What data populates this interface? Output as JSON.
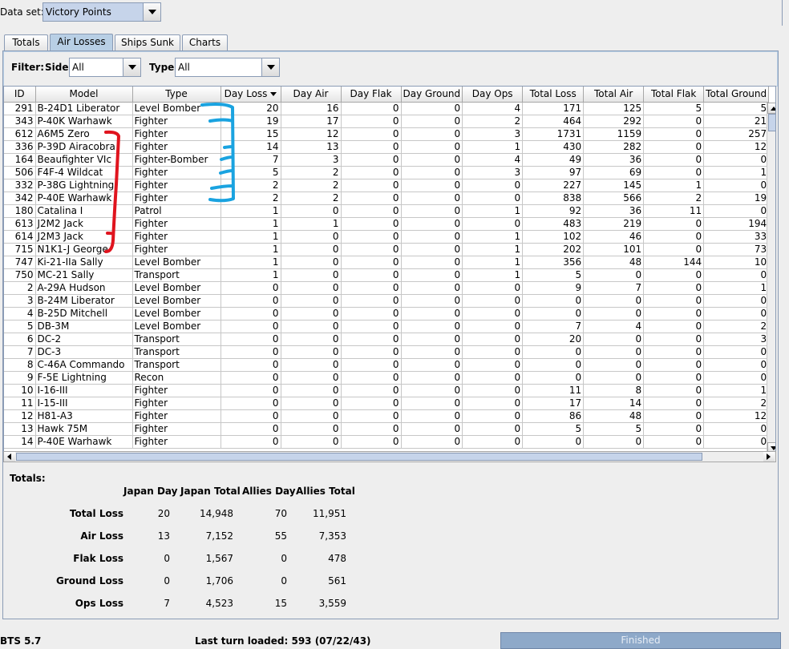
{
  "dataset": {
    "label": "Data set:",
    "value": "Victory Points"
  },
  "tabs": [
    {
      "label": "Totals"
    },
    {
      "label": "Air Losses"
    },
    {
      "label": "Ships Sunk"
    },
    {
      "label": "Charts"
    }
  ],
  "filter": {
    "label": "Filter:",
    "side_label": "Side:",
    "side_value": "All",
    "type_label": "Type:",
    "type_value": "All"
  },
  "table": {
    "columns": [
      "ID",
      "Model",
      "Type",
      "Day Loss",
      "Day Air",
      "Day Flak",
      "Day Ground",
      "Day Ops",
      "Total Loss",
      "Total Air",
      "Total Flak",
      "Total Ground"
    ],
    "sorted_column": "Day Loss",
    "rows": [
      [
        "291",
        "B-24D1 Liberator",
        "Level Bomber",
        "20",
        "16",
        "0",
        "0",
        "4",
        "171",
        "125",
        "5",
        "5"
      ],
      [
        "343",
        "P-40K Warhawk",
        "Fighter",
        "19",
        "17",
        "0",
        "0",
        "2",
        "464",
        "292",
        "0",
        "21"
      ],
      [
        "612",
        "A6M5 Zero",
        "Fighter",
        "15",
        "12",
        "0",
        "0",
        "3",
        "1731",
        "1159",
        "0",
        "257"
      ],
      [
        "336",
        "P-39D Airacobra",
        "Fighter",
        "14",
        "13",
        "0",
        "0",
        "1",
        "430",
        "282",
        "0",
        "12"
      ],
      [
        "164",
        "Beaufighter VIc",
        "Fighter-Bomber",
        "7",
        "3",
        "0",
        "0",
        "4",
        "49",
        "36",
        "0",
        "0"
      ],
      [
        "506",
        "F4F-4 Wildcat",
        "Fighter",
        "5",
        "2",
        "0",
        "0",
        "3",
        "97",
        "69",
        "0",
        "1"
      ],
      [
        "332",
        "P-38G Lightning",
        "Fighter",
        "2",
        "2",
        "0",
        "0",
        "0",
        "227",
        "145",
        "1",
        "0"
      ],
      [
        "342",
        "P-40E Warhawk",
        "Fighter",
        "2",
        "2",
        "0",
        "0",
        "0",
        "838",
        "566",
        "2",
        "19"
      ],
      [
        "180",
        "Catalina I",
        "Patrol",
        "1",
        "0",
        "0",
        "0",
        "1",
        "92",
        "36",
        "11",
        "0"
      ],
      [
        "613",
        "J2M2 Jack",
        "Fighter",
        "1",
        "1",
        "0",
        "0",
        "0",
        "483",
        "219",
        "0",
        "194"
      ],
      [
        "614",
        "J2M3 Jack",
        "Fighter",
        "1",
        "0",
        "0",
        "0",
        "1",
        "102",
        "46",
        "0",
        "33"
      ],
      [
        "715",
        "N1K1-J George",
        "Fighter",
        "1",
        "0",
        "0",
        "0",
        "1",
        "202",
        "101",
        "0",
        "73"
      ],
      [
        "747",
        "Ki-21-IIa Sally",
        "Level Bomber",
        "1",
        "0",
        "0",
        "0",
        "1",
        "356",
        "48",
        "144",
        "10"
      ],
      [
        "750",
        "MC-21 Sally",
        "Transport",
        "1",
        "0",
        "0",
        "0",
        "1",
        "5",
        "0",
        "0",
        "0"
      ],
      [
        "2",
        "A-29A Hudson",
        "Level Bomber",
        "0",
        "0",
        "0",
        "0",
        "0",
        "9",
        "7",
        "0",
        "1"
      ],
      [
        "3",
        "B-24M Liberator",
        "Level Bomber",
        "0",
        "0",
        "0",
        "0",
        "0",
        "0",
        "0",
        "0",
        "0"
      ],
      [
        "4",
        "B-25D Mitchell",
        "Level Bomber",
        "0",
        "0",
        "0",
        "0",
        "0",
        "0",
        "0",
        "0",
        "0"
      ],
      [
        "5",
        "DB-3M",
        "Level Bomber",
        "0",
        "0",
        "0",
        "0",
        "0",
        "7",
        "4",
        "0",
        "2"
      ],
      [
        "6",
        "DC-2",
        "Transport",
        "0",
        "0",
        "0",
        "0",
        "0",
        "20",
        "0",
        "0",
        "3"
      ],
      [
        "7",
        "DC-3",
        "Transport",
        "0",
        "0",
        "0",
        "0",
        "0",
        "0",
        "0",
        "0",
        "0"
      ],
      [
        "8",
        "C-46A Commando",
        "Transport",
        "0",
        "0",
        "0",
        "0",
        "0",
        "0",
        "0",
        "0",
        "0"
      ],
      [
        "9",
        "F-5E Lightning",
        "Recon",
        "0",
        "0",
        "0",
        "0",
        "0",
        "0",
        "0",
        "0",
        "0"
      ],
      [
        "10",
        "I-16-III",
        "Fighter",
        "0",
        "0",
        "0",
        "0",
        "0",
        "11",
        "8",
        "0",
        "1"
      ],
      [
        "11",
        "I-15-III",
        "Fighter",
        "0",
        "0",
        "0",
        "0",
        "0",
        "17",
        "14",
        "0",
        "2"
      ],
      [
        "12",
        "H81-A3",
        "Fighter",
        "0",
        "0",
        "0",
        "0",
        "0",
        "86",
        "48",
        "0",
        "12"
      ],
      [
        "13",
        "Hawk 75M",
        "Fighter",
        "0",
        "0",
        "0",
        "0",
        "0",
        "5",
        "5",
        "0",
        "0"
      ],
      [
        "14",
        "P-40E Warhawk",
        "Fighter",
        "0",
        "0",
        "0",
        "0",
        "0",
        "0",
        "0",
        "0",
        "0"
      ]
    ]
  },
  "totals": {
    "label": "Totals:",
    "headers": [
      "Japan Day",
      "Japan Total",
      "Allies Day",
      "Allies Total"
    ],
    "rows": [
      {
        "label": "Total Loss",
        "values": [
          "20",
          "14,948",
          "70",
          "11,951"
        ]
      },
      {
        "label": "Air Loss",
        "values": [
          "13",
          "7,152",
          "55",
          "7,353"
        ]
      },
      {
        "label": "Flak Loss",
        "values": [
          "0",
          "1,567",
          "0",
          "478"
        ]
      },
      {
        "label": "Ground Loss",
        "values": [
          "0",
          "1,706",
          "0",
          "561"
        ]
      },
      {
        "label": "Ops Loss",
        "values": [
          "7",
          "4,523",
          "15",
          "3,559"
        ]
      }
    ]
  },
  "status": {
    "version": "BTS 5.7",
    "last_turn": "Last turn loaded: 593 (07/22/43)",
    "progress_text": "Finished"
  },
  "colors": {
    "selected_tab": "#b8cfe5",
    "annotation_blue": "#1aa3e0",
    "annotation_red": "#e0141e",
    "progress": "#8ea9c9"
  }
}
